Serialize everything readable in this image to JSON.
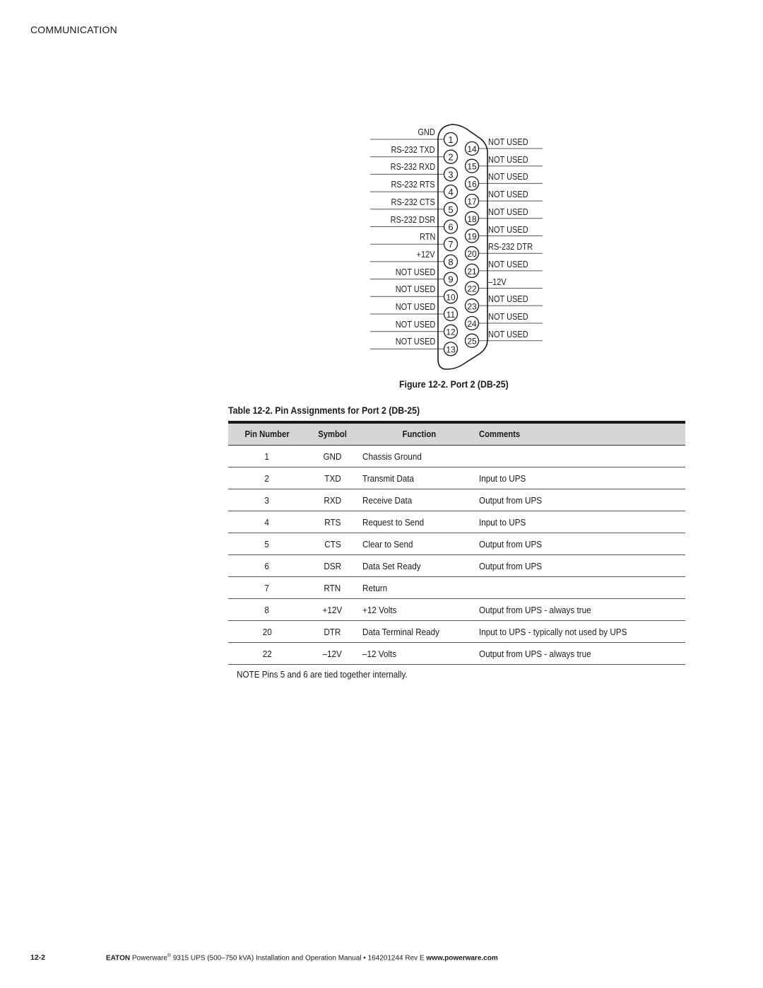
{
  "header": {
    "section": "COMMUNICATION"
  },
  "diagram": {
    "left_pins": [
      {
        "pin": "1",
        "label": "GND"
      },
      {
        "pin": "2",
        "label": "RS-232 TXD"
      },
      {
        "pin": "3",
        "label": "RS-232 RXD"
      },
      {
        "pin": "4",
        "label": "RS-232 RTS"
      },
      {
        "pin": "5",
        "label": "RS-232 CTS"
      },
      {
        "pin": "6",
        "label": "RS-232 DSR"
      },
      {
        "pin": "7",
        "label": "RTN"
      },
      {
        "pin": "8",
        "label": "+12V"
      },
      {
        "pin": "9",
        "label": "NOT USED"
      },
      {
        "pin": "10",
        "label": "NOT USED"
      },
      {
        "pin": "11",
        "label": "NOT USED"
      },
      {
        "pin": "12",
        "label": "NOT USED"
      },
      {
        "pin": "13",
        "label": "NOT USED"
      }
    ],
    "right_pins": [
      {
        "pin": "14",
        "label": "NOT USED"
      },
      {
        "pin": "15",
        "label": "NOT USED"
      },
      {
        "pin": "16",
        "label": "NOT USED"
      },
      {
        "pin": "17",
        "label": "NOT USED"
      },
      {
        "pin": "18",
        "label": "NOT USED"
      },
      {
        "pin": "19",
        "label": "NOT USED"
      },
      {
        "pin": "20",
        "label": "RS-232 DTR"
      },
      {
        "pin": "21",
        "label": "NOT USED"
      },
      {
        "pin": "22",
        "label": "–12V"
      },
      {
        "pin": "23",
        "label": "NOT USED"
      },
      {
        "pin": "24",
        "label": "NOT USED"
      },
      {
        "pin": "25",
        "label": "NOT USED"
      }
    ]
  },
  "figure_caption": "Figure 12-2. Port 2 (DB-25)",
  "table": {
    "caption": "Table 12-2. Pin Assignments for Port 2 (DB-25)",
    "columns": [
      "Pin Number",
      "Symbol",
      "Function",
      "Comments"
    ],
    "rows": [
      [
        "1",
        "GND",
        "Chassis Ground",
        ""
      ],
      [
        "2",
        "TXD",
        "Transmit Data",
        "Input to UPS"
      ],
      [
        "3",
        "RXD",
        "Receive Data",
        "Output from UPS"
      ],
      [
        "4",
        "RTS",
        "Request to Send",
        "Input to UPS"
      ],
      [
        "5",
        "CTS",
        "Clear to Send",
        "Output from UPS"
      ],
      [
        "6",
        "DSR",
        "Data Set Ready",
        "Output from UPS"
      ],
      [
        "7",
        "RTN",
        "Return",
        ""
      ],
      [
        "8",
        "+12V",
        "+12 Volts",
        "Output from UPS - always true"
      ],
      [
        "20",
        "DTR",
        "Data Terminal Ready",
        "Input to UPS - typically not used by UPS"
      ],
      [
        "22",
        "–12V",
        "–12 Volts",
        "Output from UPS - always true"
      ]
    ]
  },
  "note": "NOTE  Pins 5 and 6 are tied together internally.",
  "footer": {
    "page_number": "12-2",
    "brand": "EATON",
    "product": "Powerware",
    "registered": "®",
    "text": " 9315 UPS (500–750 kVA) Installation and Operation Manual  •  164201244 Rev E ",
    "website": "www.powerware.com"
  }
}
